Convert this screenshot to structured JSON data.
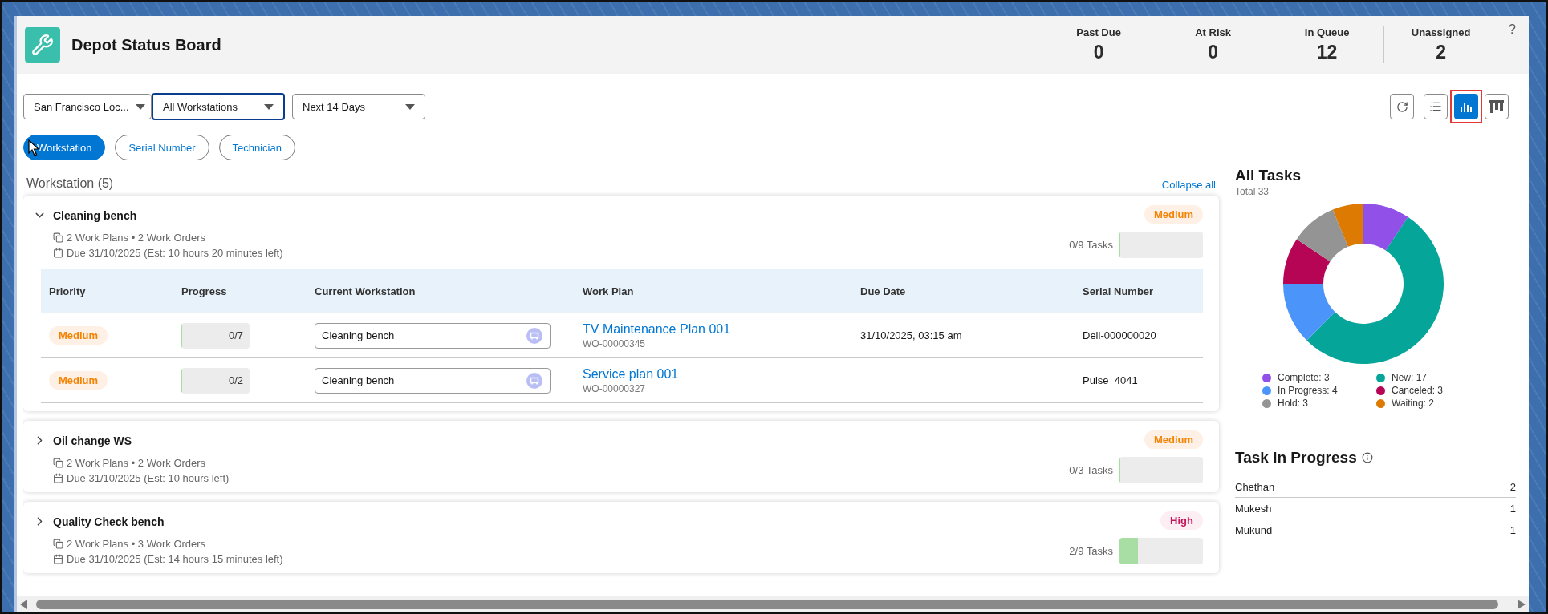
{
  "header": {
    "title": "Depot Status Board",
    "stats": [
      {
        "label": "Past Due",
        "value": "0"
      },
      {
        "label": "At Risk",
        "value": "0"
      },
      {
        "label": "In Queue",
        "value": "12"
      },
      {
        "label": "Unassigned",
        "value": "2"
      }
    ],
    "help": "?"
  },
  "filters": [
    {
      "value": "San Francisco Loc...",
      "focused": false
    },
    {
      "value": "All Workstations",
      "focused": true
    },
    {
      "value": "Next 14 Days",
      "focused": false
    }
  ],
  "view_buttons": [
    {
      "kind": "refresh",
      "selected": false,
      "highlighted": false
    },
    {
      "kind": "list",
      "selected": false,
      "highlighted": false
    },
    {
      "kind": "chart",
      "selected": true,
      "highlighted": true
    },
    {
      "kind": "board",
      "selected": false,
      "highlighted": false
    }
  ],
  "group_by": [
    {
      "label": "Workstation",
      "selected": true
    },
    {
      "label": "Serial Number",
      "selected": false
    },
    {
      "label": "Technician",
      "selected": false
    }
  ],
  "list": {
    "title": "Workstation (5)",
    "collapse_link": "Collapse all"
  },
  "columns": [
    "Priority",
    "Progress",
    "Current Workstation",
    "Work Plan",
    "Due Date",
    "Serial Number"
  ],
  "workstations": [
    {
      "name": "Cleaning bench",
      "expanded": true,
      "priority": {
        "label": "Medium",
        "kind": "medium"
      },
      "summary": "2 Work Plans • 2 Work Orders",
      "due": "Due 31/10/2025 (Est: 10 hours 20 minutes left)",
      "tasks": "0/9 Tasks",
      "level": 0,
      "rows": [
        {
          "priority": {
            "label": "Medium",
            "kind": "medium"
          },
          "progress": "0/7",
          "level": 0,
          "workstation": "Cleaning bench",
          "work_plan": "TV Maintenance Plan 001",
          "work_order": "WO-00000345",
          "due_date": "31/10/2025, 03:15 am",
          "serial": "Dell-000000020"
        },
        {
          "priority": {
            "label": "Medium",
            "kind": "medium"
          },
          "progress": "0/2",
          "level": 0,
          "workstation": "Cleaning bench",
          "work_plan": "Service plan 001",
          "work_order": "WO-00000327",
          "serial": "Pulse_4041"
        }
      ]
    },
    {
      "name": "Oil change WS",
      "expanded": false,
      "priority": {
        "label": "Medium",
        "kind": "medium"
      },
      "summary": "2 Work Plans • 2 Work Orders",
      "due": "Due 31/10/2025 (Est: 10 hours left)",
      "tasks": "0/3 Tasks",
      "level": 0
    },
    {
      "name": "Quality Check bench",
      "expanded": false,
      "priority": {
        "label": "High",
        "kind": "high"
      },
      "summary": "2 Work Plans • 3 Work Orders",
      "due": "Due 31/10/2025 (Est: 14 hours 15 minutes left)",
      "tasks": "2/9 Tasks",
      "level": 0.22
    }
  ],
  "all_tasks": {
    "title": "All Tasks",
    "total": "Total 33",
    "chart_data": {
      "type": "donut",
      "categories": [
        "Complete: 3",
        "New: 17",
        "In Progress: 4",
        "Canceled: 3",
        "Hold: 3",
        "Waiting: 2"
      ],
      "values": [
        3,
        17,
        4,
        3,
        3,
        2
      ]
    },
    "slices": [
      {
        "color": "#9150e8"
      },
      {
        "color": "#06a59a"
      },
      {
        "color": "#4a94fa"
      },
      {
        "color": "#b60554"
      },
      {
        "color": "#949494"
      },
      {
        "color": "#dd7a01"
      }
    ]
  },
  "task_in_progress": {
    "title": "Task in Progress",
    "rows": [
      {
        "name": "Chethan",
        "count": "2"
      },
      {
        "name": "Mukesh",
        "count": "1"
      },
      {
        "name": "Mukund",
        "count": "1"
      }
    ]
  }
}
